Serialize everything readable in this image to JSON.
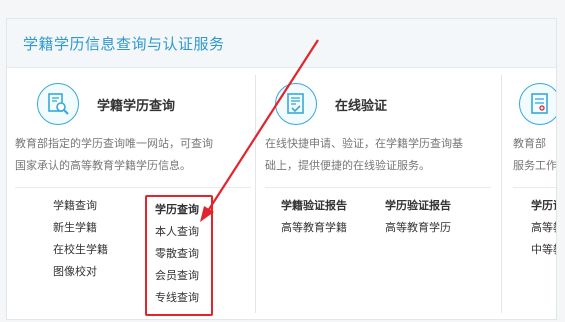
{
  "header": {
    "title": "学籍学历信息查询与认证服务"
  },
  "cards": {
    "left": {
      "title": "学籍学历查询",
      "desc_line1": "教育部指定的学历查询唯一网站，可查询",
      "desc_line2": "国家承认的高等教育学籍学历信息。",
      "col1": [
        "学籍查询",
        "新生学籍",
        "在校生学籍",
        "图像校对"
      ],
      "col2": [
        "学历查询",
        "本人查询",
        "零散查询",
        "会员查询",
        "专线查询"
      ]
    },
    "mid": {
      "title": "在线验证",
      "desc_line1": "在线快捷申请、验证，在学籍学历查询基",
      "desc_line2": "础上，提供便捷的在线验证服务。",
      "col1": [
        "学籍验证报告",
        "高等教育学籍"
      ],
      "col2": [
        "学历验证报告",
        "高等教育学历"
      ]
    },
    "right": {
      "desc_line1": "教育部",
      "desc_line2": "服务工作",
      "col1": [
        "学历证",
        "高等教",
        "中等教"
      ]
    }
  },
  "colors": {
    "accent": "#2f98cf",
    "highlight": "#e2242d"
  },
  "icons": {
    "left": "magnifier-document-icon",
    "mid": "certificate-check-icon",
    "right": "document-icon"
  }
}
